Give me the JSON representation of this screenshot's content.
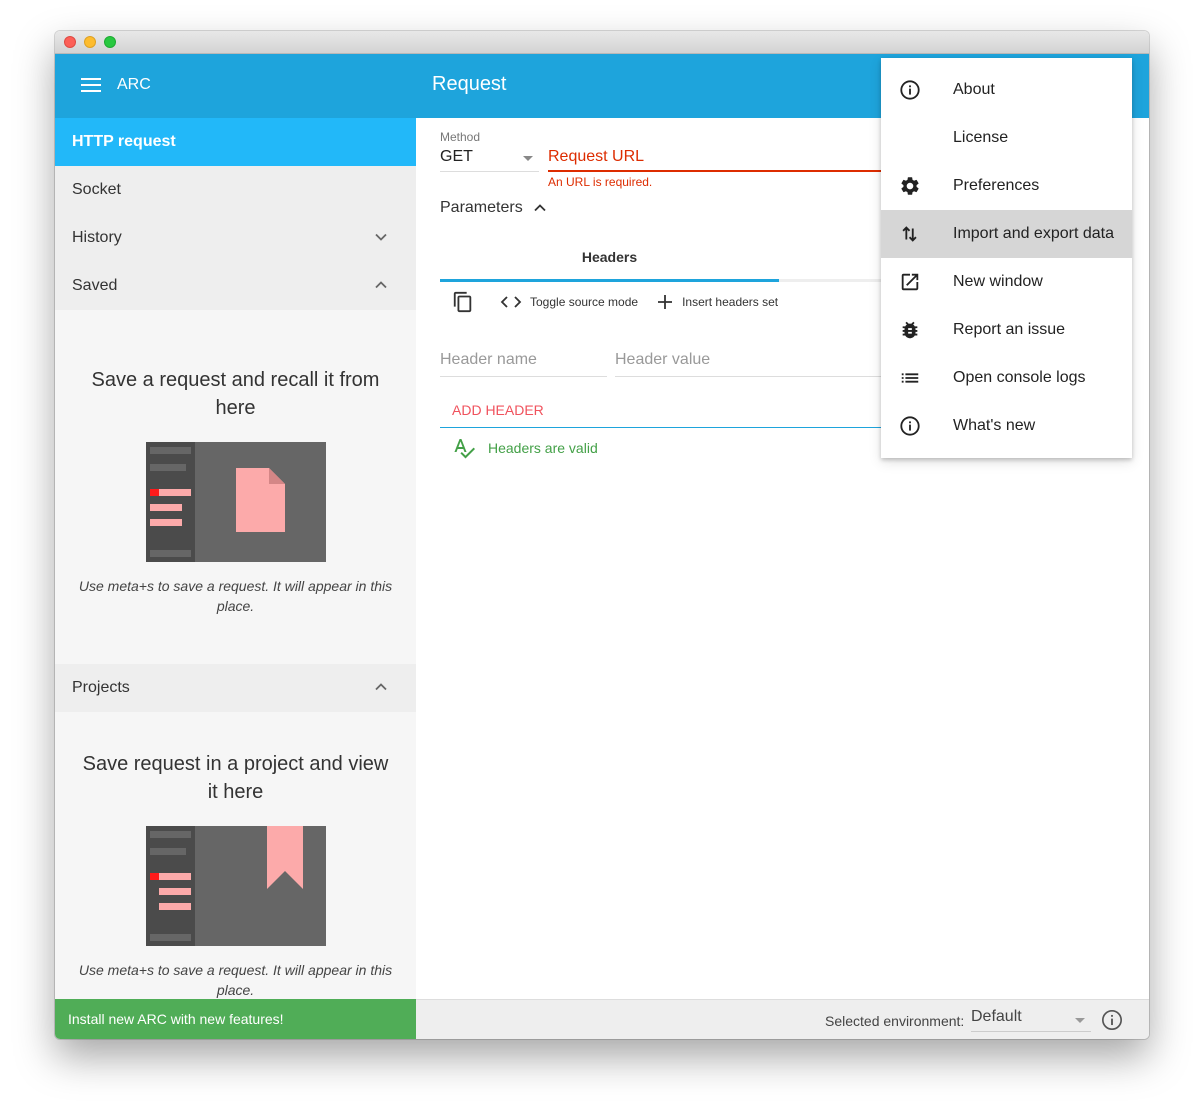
{
  "window": {
    "traffic_lights": [
      "close",
      "minimize",
      "maximize"
    ]
  },
  "appbar": {
    "app_name": "ARC",
    "page_title": "Request",
    "menu_icon": "hamburger-menu-icon"
  },
  "sidebar": {
    "items": [
      {
        "label": "HTTP request",
        "active": true
      },
      {
        "label": "Socket"
      },
      {
        "label": "History",
        "icon": "chevron-down-icon"
      },
      {
        "label": "Saved",
        "icon": "chevron-up-icon"
      }
    ],
    "saved_empty": {
      "title": "Save a request and recall it from here",
      "description": "Use meta+s to save a request. It will appear in this place."
    },
    "projects": {
      "label": "Projects",
      "icon": "chevron-up-icon"
    },
    "projects_empty": {
      "title": "Save request in a project and view it here",
      "description": "Use meta+s to save a request. It will appear in this place."
    },
    "promo": "Install new ARC with new features!"
  },
  "request": {
    "method_label": "Method",
    "method_value": "GET",
    "url_placeholder": "Request URL",
    "url_error": "An URL is required.",
    "parameters_label": "Parameters",
    "tabs": [
      {
        "label": "Headers",
        "active": true
      }
    ],
    "toolbar": {
      "copy_icon": "copy-icon",
      "toggle_source": "Toggle source mode",
      "insert_set": "Insert headers set"
    },
    "header_name_placeholder": "Header name",
    "header_value_placeholder": "Header value",
    "add_header": "ADD HEADER",
    "validation": "Headers are valid"
  },
  "statusbar": {
    "env_label": "Selected environment:",
    "env_value": "Default"
  },
  "menu": {
    "items": [
      {
        "label": "About",
        "icon": "info-icon"
      },
      {
        "label": "License",
        "icon": ""
      },
      {
        "label": "Preferences",
        "icon": "gear-icon"
      },
      {
        "label": "Import and export data",
        "icon": "import-export-icon",
        "highlighted": true
      },
      {
        "label": "New window",
        "icon": "open-in-new-icon"
      },
      {
        "label": "Report an issue",
        "icon": "bug-icon"
      },
      {
        "label": "Open console logs",
        "icon": "list-icon"
      },
      {
        "label": "What's new",
        "icon": "info-icon"
      }
    ]
  },
  "colors": {
    "primary": "#1ea4dc",
    "active_nav": "#22b8f9",
    "error": "#dd2c00",
    "add_header": "#f0525d",
    "valid": "#43a047",
    "promo": "#50ad57"
  }
}
